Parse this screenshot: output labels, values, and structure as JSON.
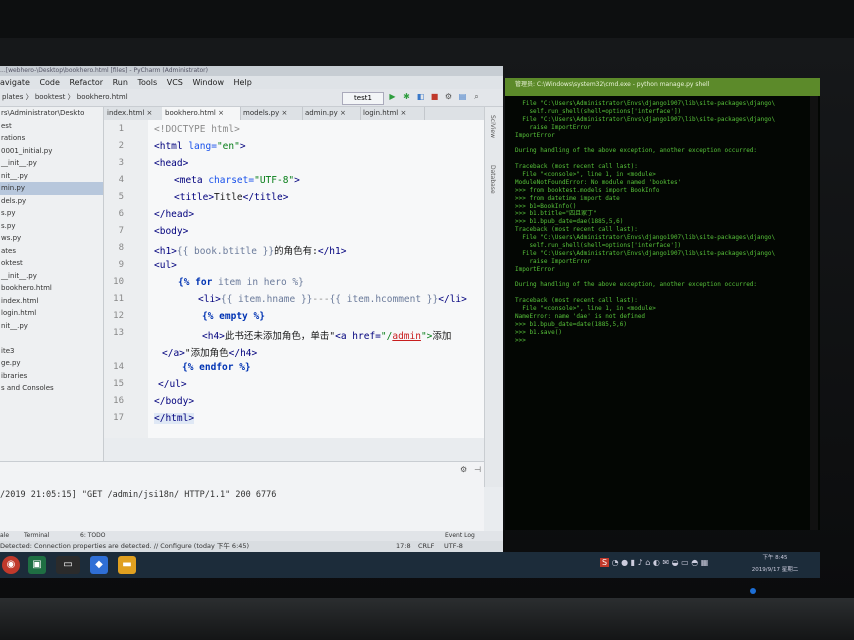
{
  "ide": {
    "window_title": "...[webhero-\\Desktop\\bookhero.html [files] - PyCharm (Administrator)",
    "menu": [
      "avigate",
      "Code",
      "Refactor",
      "Run",
      "Tools",
      "VCS",
      "Window",
      "Help"
    ],
    "breadcrumb": "plates 〉 booktest 〉 bookhero.html",
    "run_config": "test1",
    "project_tree": [
      "rs\\Administrator\\Deskto",
      "est",
      "rations",
      "0001_initial.py",
      "__init__.py",
      "nit__.py",
      "min.py",
      "dels.py",
      "s.py",
      "s.py",
      "ws.py",
      "ates",
      "oktest",
      "__init__.py",
      "bookhero.html",
      "index.html",
      "login.html",
      "nit__.py",
      "",
      "ite3",
      "ge.py",
      "ibraries",
      "s and Consoles"
    ],
    "selected_tree_index": 6,
    "tabs": [
      "index.html",
      "bookhero.html",
      "models.py",
      "admin.py",
      "login.html"
    ],
    "active_tab": 1,
    "line_numbers": [
      "1",
      "2",
      "3",
      "4",
      "5",
      "6",
      "7",
      "8",
      "9",
      "10",
      "11",
      "12",
      "13",
      "",
      "14",
      "15",
      "16",
      "17"
    ],
    "side_strip": [
      "SciView",
      "Database"
    ],
    "run_output": "/2019 21:05:15] \"GET /admin/jsi18n/ HTTP/1.1\" 200 6776",
    "bottom_tabs": [
      "ale",
      "Terminal",
      "6: TODO",
      "Event Log"
    ],
    "status_message": "Detected: Connection properties are detected. // Configure (today 下午 6:45)",
    "cursor_pos": "17:8",
    "line_sep": "CRLF",
    "encoding": "UTF-8"
  },
  "code": {
    "l1": "<!DOCTYPE html>",
    "l2_open": "<html",
    "l2_attr": " lang=",
    "l2_val": "\"en\"",
    "l2_close": ">",
    "l3": "<head>",
    "l4_open": "<meta",
    "l4_attr": " charset=",
    "l4_val": "\"UTF-8\"",
    "l4_close": ">",
    "l5_open": "<title>",
    "l5_text": "Title",
    "l5_close": "</title>",
    "l6": "</head>",
    "l7": "<body>",
    "l8_open": "<h1>",
    "l8_tpl": "{{ book.btitle }}",
    "l8_text": "的角色有:",
    "l8_close": "</h1>",
    "l9": "<ul>",
    "l10_kw": "{% for",
    "l10_rest": " item in hero %}",
    "l11_open": "<li>",
    "l11_tpl1": "{{ item.hname }}",
    "l11_sep": "---",
    "l11_tpl2": "{{ item.hcomment }}",
    "l11_close": "</li>",
    "l12": "{% empty %}",
    "l13_open": "<h4>",
    "l13_text": "此书还未添加角色，单击\"",
    "l13_a": "<a href=",
    "l13_q1": "\"/",
    "l13_admin": "admin",
    "l13_q2": "\">",
    "l13_tail": "添加",
    "l13b_a": "</a>",
    "l13b_text": "\"添加角色",
    "l13b_close": "</h4>",
    "l14": "{% endfor %}",
    "l15": "</ul>",
    "l16": "</body>",
    "l17": "</html>"
  },
  "terminal": {
    "title": "管理员: C:\\Windows\\system32\\cmd.exe - python manage.py shell",
    "lines": [
      "  File \"C:\\Users\\Administrator\\Envs\\django1907\\lib\\site-packages\\django\\",
      "    self.run_shell(shell=options['interface'])",
      "  File \"C:\\Users\\Administrator\\Envs\\django1907\\lib\\site-packages\\django\\",
      "    raise ImportError",
      "ImportError",
      "",
      "During handling of the above exception, another exception occurred:",
      "",
      "Traceback (most recent call last):",
      "  File \"<console>\", line 1, in <module>",
      "ModuleNotFoundError: No module named 'booktes'",
      ">>> from booktest.models import BookInfo",
      ">>> from datetime import date",
      ">>> b1=BookInfo()",
      ">>> b1.btitle=\"四且家丁\"",
      ">>> b1.bpub_date=dae(1885,5,6)",
      "Traceback (most recent call last):",
      "  File \"C:\\Users\\Administrator\\Envs\\django1907\\lib\\site-packages\\django\\",
      "    self.run_shell(shell=options['interface'])",
      "  File \"C:\\Users\\Administrator\\Envs\\django1907\\lib\\site-packages\\django\\",
      "    raise ImportError",
      "ImportError",
      "",
      "During handling of the above exception, another exception occurred:",
      "",
      "Traceback (most recent call last):",
      "  File \"<console>\", line 1, in <module>",
      "NameError: name 'dae' is not defined",
      ">>> b1.bpub_date=date(1885,5,6)",
      ">>> b1.save()",
      ">>>"
    ]
  },
  "taskbar": {
    "clock_time": "下午 8:45",
    "clock_date": "2019/9/17 星期二"
  }
}
